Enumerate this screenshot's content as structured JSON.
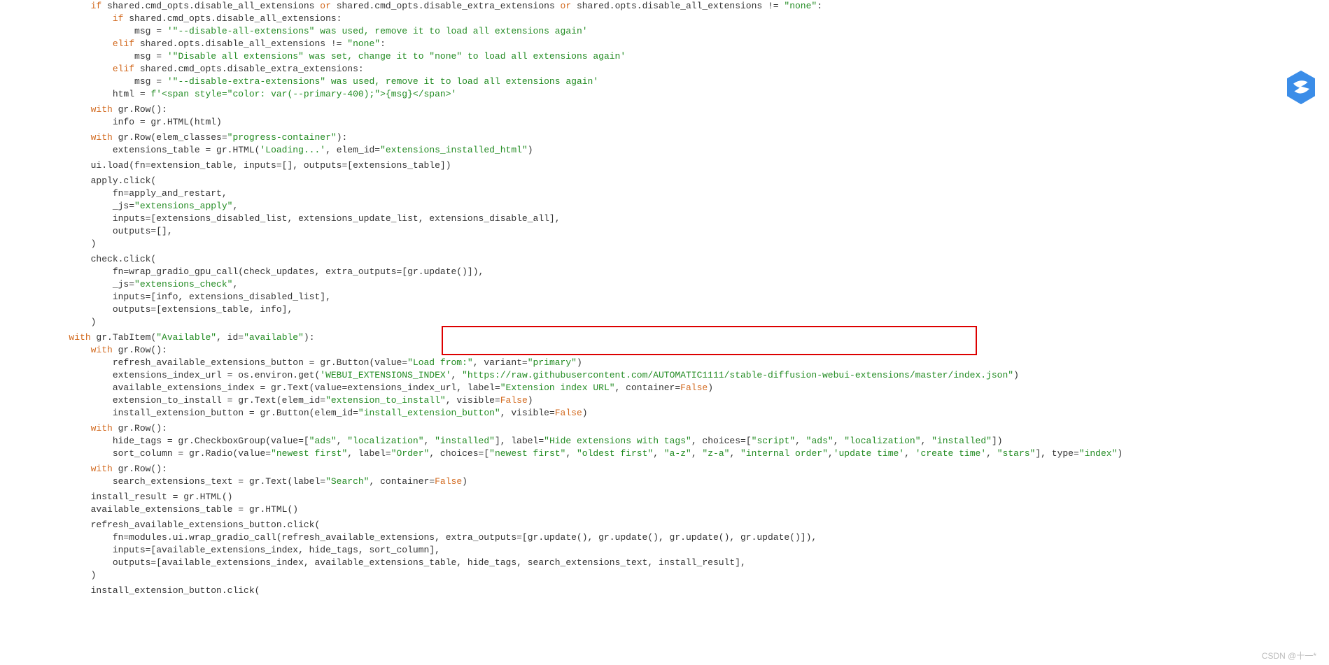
{
  "highlight": {
    "url": "https://raw.githubusercontent.com/AUTOMATIC1111/stable-diffusion-webui-extensions/master/index.json"
  },
  "watermark": "CSDN @十一*",
  "code": {
    "l01a": "            if",
    "l01b": " shared.cmd_opts.disable_all_extensions ",
    "l01c": "or",
    "l01d": " shared.cmd_opts.disable_extra_extensions ",
    "l01e": "or",
    "l01f": " shared.opts.disable_all_extensions != ",
    "l01g": "\"none\"",
    "l01h": ":",
    "l02a": "                if",
    "l02b": " shared.cmd_opts.disable_all_extensions:",
    "l03a": "                    msg = ",
    "l03b": "'\"--disable-all-extensions\" was used, remove it to load all extensions again'",
    "l04a": "                elif",
    "l04b": " shared.opts.disable_all_extensions != ",
    "l04c": "\"none\"",
    "l04d": ":",
    "l05a": "                    msg = ",
    "l05b": "'\"Disable all extensions\" was set, change it to \"none\" to load all extensions again'",
    "l06a": "                elif",
    "l06b": " shared.cmd_opts.disable_extra_extensions:",
    "l07a": "                    msg = ",
    "l07b": "'\"--disable-extra-extensions\" was used, remove it to load all extensions again'",
    "l08a": "                html = ",
    "l08b": "f'<span style=\"color: var(--primary-400);\">{msg}</span>'",
    "l09": "",
    "l10a": "            with",
    "l10b": " gr.Row():",
    "l11": "                info = gr.HTML(html)",
    "l12": "",
    "l13a": "            with",
    "l13b": " gr.Row(elem_classes=",
    "l13c": "\"progress-container\"",
    "l13d": "):",
    "l14a": "                extensions_table = gr.HTML(",
    "l14b": "'Loading...'",
    "l14c": ", elem_id=",
    "l14d": "\"extensions_installed_html\"",
    "l14e": ")",
    "l15": "",
    "l16": "            ui.load(fn=extension_table, inputs=[], outputs=[extensions_table])",
    "l17": "",
    "l18": "            apply.click(",
    "l19": "                fn=apply_and_restart,",
    "l20a": "                _js=",
    "l20b": "\"extensions_apply\"",
    "l20c": ",",
    "l21": "                inputs=[extensions_disabled_list, extensions_update_list, extensions_disable_all],",
    "l22": "                outputs=[],",
    "l23": "            )",
    "l24": "",
    "l25": "            check.click(",
    "l26": "                fn=wrap_gradio_gpu_call(check_updates, extra_outputs=[gr.update()]),",
    "l27a": "                _js=",
    "l27b": "\"extensions_check\"",
    "l27c": ",",
    "l28": "                inputs=[info, extensions_disabled_list],",
    "l29": "                outputs=[extensions_table, info],",
    "l30": "            )",
    "l31": "",
    "l32a": "        with",
    "l32b": " gr.TabItem(",
    "l32c": "\"Available\"",
    "l32d": ", id=",
    "l32e": "\"available\"",
    "l32f": "):",
    "l33a": "            with",
    "l33b": " gr.Row():",
    "l34a": "                refresh_available_extensions_button = gr.Button(value=",
    "l34b": "\"Load from:\"",
    "l34c": ", variant=",
    "l34d": "\"primary\"",
    "l34e": ")",
    "l35a": "                extensions_index_url = os.environ.get(",
    "l35b": "'WEBUI_EXTENSIONS_INDEX'",
    "l35c": ", ",
    "l35d": "\"https://raw.githubusercontent.com/AUTOMATIC1111/stable-diffusion-webui-extensions/master/index.json\"",
    "l35e": ")",
    "l36a": "                available_extensions_index = gr.Text(value=extensions_index_url, label=",
    "l36b": "\"Extension index URL\"",
    "l36c": ", container=",
    "l36d": "False",
    "l36e": ")",
    "l37a": "                extension_to_install = gr.Text(elem_id=",
    "l37b": "\"extension_to_install\"",
    "l37c": ", visible=",
    "l37d": "False",
    "l37e": ")",
    "l38a": "                install_extension_button = gr.Button(elem_id=",
    "l38b": "\"install_extension_button\"",
    "l38c": ", visible=",
    "l38d": "False",
    "l38e": ")",
    "l39": "",
    "l40a": "            with",
    "l40b": " gr.Row():",
    "l41a": "                hide_tags = gr.CheckboxGroup(value=[",
    "l41b": "\"ads\"",
    "l41c": ", ",
    "l41d": "\"localization\"",
    "l41e": ", ",
    "l41f": "\"installed\"",
    "l41g": "], label=",
    "l41h": "\"Hide extensions with tags\"",
    "l41i": ", choices=[",
    "l41j": "\"script\"",
    "l41k": ", ",
    "l41l": "\"ads\"",
    "l41m": ", ",
    "l41n": "\"localization\"",
    "l41o": ", ",
    "l41p": "\"installed\"",
    "l41q": "])",
    "l42a": "                sort_column = gr.Radio(value=",
    "l42b": "\"newest first\"",
    "l42c": ", label=",
    "l42d": "\"Order\"",
    "l42e": ", choices=[",
    "l42f": "\"newest first\"",
    "l42g": ", ",
    "l42h": "\"oldest first\"",
    "l42i": ", ",
    "l42j": "\"a-z\"",
    "l42k": ", ",
    "l42l": "\"z-a\"",
    "l42m": ", ",
    "l42n": "\"internal order\"",
    "l42o": ",",
    "l42p": "'update time'",
    "l42q": ", ",
    "l42r": "'create time'",
    "l42s": ", ",
    "l42t": "\"stars\"",
    "l42u": "], type=",
    "l42v": "\"index\"",
    "l42w": ")",
    "l43": "",
    "l44a": "            with",
    "l44b": " gr.Row():",
    "l45a": "                search_extensions_text = gr.Text(label=",
    "l45b": "\"Search\"",
    "l45c": ", container=",
    "l45d": "False",
    "l45e": ")",
    "l46": "",
    "l47": "            install_result = gr.HTML()",
    "l48": "            available_extensions_table = gr.HTML()",
    "l49": "",
    "l50": "            refresh_available_extensions_button.click(",
    "l51": "                fn=modules.ui.wrap_gradio_call(refresh_available_extensions, extra_outputs=[gr.update(), gr.update(), gr.update(), gr.update()]),",
    "l52": "                inputs=[available_extensions_index, hide_tags, sort_column],",
    "l53": "                outputs=[available_extensions_index, available_extensions_table, hide_tags, search_extensions_text, install_result],",
    "l54": "            )",
    "l55": "",
    "l56": "            install_extension_button.click("
  }
}
